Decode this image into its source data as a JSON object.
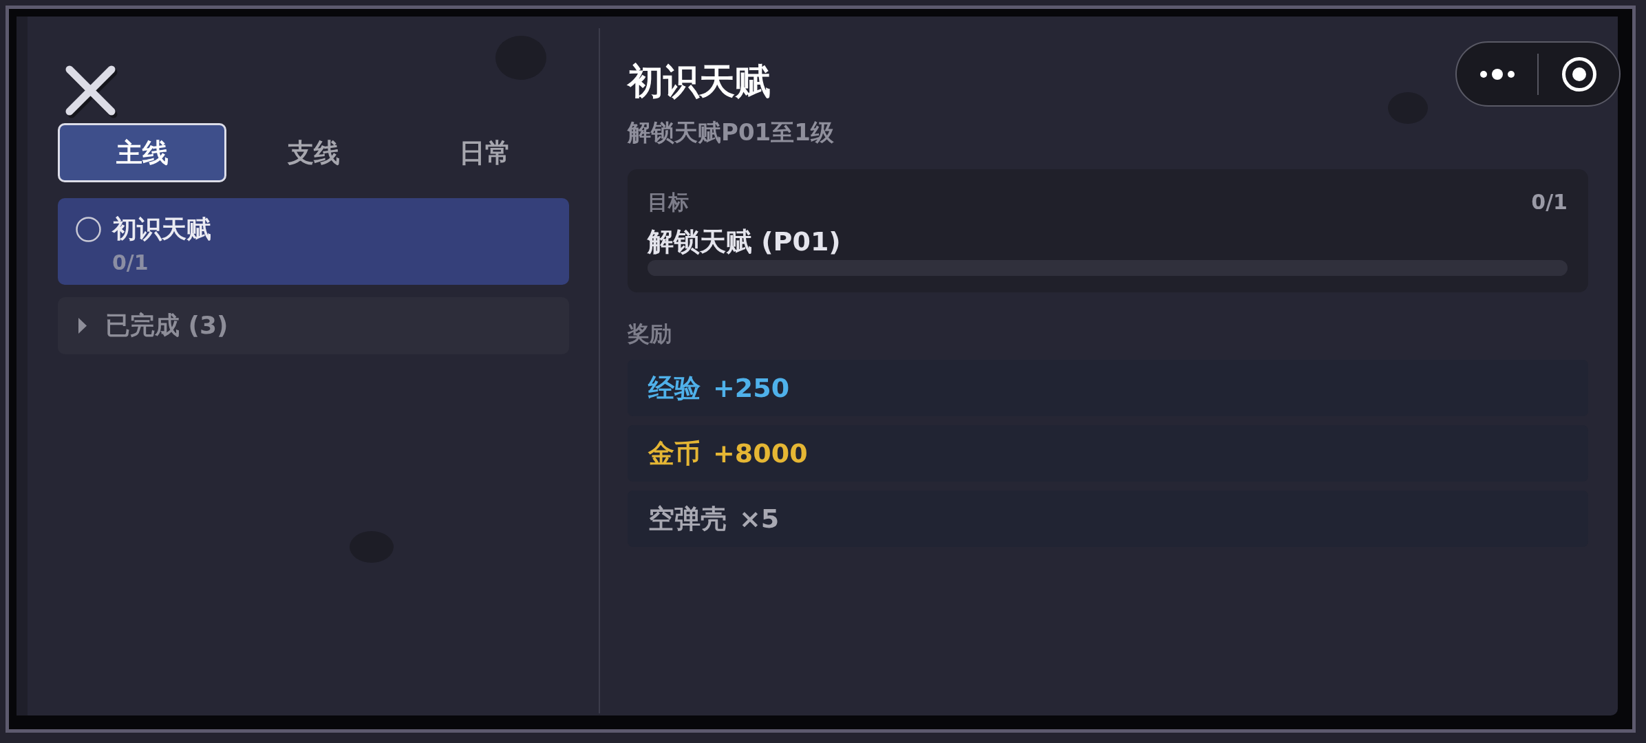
{
  "tabs": [
    {
      "label": "主线",
      "selected": true
    },
    {
      "label": "支线",
      "selected": false
    },
    {
      "label": "日常",
      "selected": false
    }
  ],
  "quests": [
    {
      "title": "初识天赋",
      "progress": "0/1",
      "selected": true,
      "completed": false
    }
  ],
  "completed_group": {
    "label": "已完成 (3)",
    "expanded": false
  },
  "detail": {
    "title": "初识天赋",
    "subtitle": "解锁天赋P01至1级",
    "goal": {
      "label": "目标",
      "count": "0/1",
      "text": "解锁天赋 (P01)",
      "level": 0
    },
    "rewards_label": "奖励",
    "rewards": [
      {
        "name": "经验",
        "amount": "+250",
        "color": "#4fb1ea"
      },
      {
        "name": "金币",
        "amount": "+8000",
        "color": "#e5b634"
      },
      {
        "name": "空弹壳",
        "amount": "×5",
        "color": "#a9a9b3"
      }
    ]
  }
}
